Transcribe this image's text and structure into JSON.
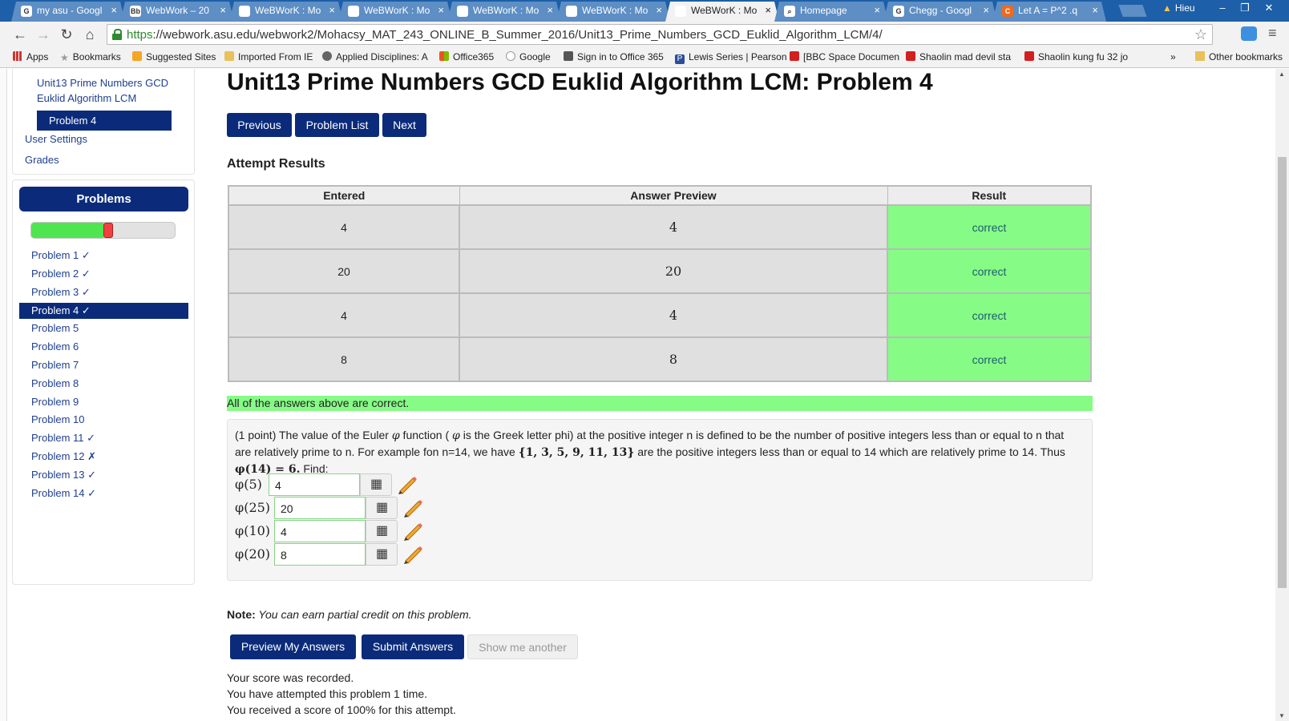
{
  "browser": {
    "tabs": [
      {
        "title": "my asu - Googl",
        "icon": "G"
      },
      {
        "title": "WebWork – 20",
        "icon": "Bb"
      },
      {
        "title": "WeBWorK : Mo",
        "icon": "doc"
      },
      {
        "title": "WeBWorK : Mo",
        "icon": "doc"
      },
      {
        "title": "WeBWorK : Mo",
        "icon": "doc"
      },
      {
        "title": "WeBWorK : Mo",
        "icon": "doc"
      },
      {
        "title": "WeBWorK : Mo",
        "icon": "doc"
      },
      {
        "title": "Homepage",
        "icon": "search"
      },
      {
        "title": "Chegg - Googl",
        "icon": "G"
      },
      {
        "title": "Let A = P^2 .q",
        "icon": "C"
      }
    ],
    "active_tab_index": 6,
    "user": "Hieu",
    "url_https": "https",
    "url_rest": "://webwork.asu.edu/webwork2/Mohacsy_MAT_243_ONLINE_B_Summer_2016/Unit13_Prime_Numbers_GCD_Euklid_Algorithm_LCM/4/",
    "bookmarks": [
      "Apps",
      "Bookmarks",
      "Suggested Sites",
      "Imported From IE",
      "Applied Disciplines: A",
      "Office365",
      "Google",
      "Sign in to Office 365",
      "Lewis Series | Pearson",
      "[BBC Space Documen",
      "Shaolin mad devil sta",
      "Shaolin kung fu 32 jo"
    ],
    "bookmark_overflow": "»",
    "other_bookmarks": "Other bookmarks"
  },
  "sidebar": {
    "set_link_line1": "Unit13 Prime Numbers GCD",
    "set_link_line2": "Euklid Algorithm LCM",
    "active_problem": "Problem 4",
    "user_settings": "User Settings",
    "grades": "Grades",
    "problems_header": "Problems",
    "progress_correct_fraction": 0.5,
    "progress_incorrect_fraction": 0.071,
    "problems": [
      {
        "label": "Problem 1 ✓",
        "current": false
      },
      {
        "label": "Problem 2 ✓",
        "current": false
      },
      {
        "label": "Problem 3 ✓",
        "current": false
      },
      {
        "label": "Problem 4 ✓",
        "current": true
      },
      {
        "label": "Problem 5",
        "current": false
      },
      {
        "label": "Problem 6",
        "current": false
      },
      {
        "label": "Problem 7",
        "current": false
      },
      {
        "label": "Problem 8",
        "current": false
      },
      {
        "label": "Problem 9",
        "current": false
      },
      {
        "label": "Problem 10",
        "current": false
      },
      {
        "label": "Problem 11 ✓",
        "current": false
      },
      {
        "label": "Problem 12 ✗",
        "current": false
      },
      {
        "label": "Problem 13 ✓",
        "current": false
      },
      {
        "label": "Problem 14 ✓",
        "current": false
      }
    ]
  },
  "main": {
    "title": "Unit13 Prime Numbers GCD Euklid Algorithm LCM: Problem 4",
    "nav": {
      "previous": "Previous",
      "problem_list": "Problem List",
      "next": "Next"
    },
    "attempt_title": "Attempt Results",
    "table_headers": [
      "Entered",
      "Answer Preview",
      "Result"
    ],
    "table_rows": [
      {
        "entered": "4",
        "preview": "4",
        "result": "correct"
      },
      {
        "entered": "20",
        "preview": "20",
        "result": "correct"
      },
      {
        "entered": "4",
        "preview": "4",
        "result": "correct"
      },
      {
        "entered": "8",
        "preview": "8",
        "result": "correct"
      }
    ],
    "all_correct": "All of the answers above are correct.",
    "problem": {
      "p1": "(1 point) The value of the Euler ",
      "phi": "φ",
      "p2": " function ( ",
      "p3": " is the Greek letter phi) at the positive integer n is defined to be the number of positive integers less than or equal to n that are relatively prime to n. For example fon n=14, we have ",
      "set": "{1, 3, 5, 9, 11, 13}",
      "p4": " are the positive integers less than or equal to 14 which are relatively prime to 14. Thus ",
      "thus_expr": "φ(14) = 6.",
      "p5": " Find:",
      "answers": [
        {
          "label": "φ(5)",
          "value": "4"
        },
        {
          "label": "φ(25)",
          "value": "20"
        },
        {
          "label": "φ(10)",
          "value": "4"
        },
        {
          "label": "φ(20)",
          "value": "8"
        }
      ]
    },
    "note_label": "Note:",
    "note_text": " You can earn partial credit on this problem.",
    "buttons": {
      "preview": "Preview My Answers",
      "submit": "Submit Answers",
      "another": "Show me another"
    },
    "status": [
      "Your score was recorded.",
      "You have attempted this problem 1 time.",
      "You received a score of 100% for this attempt."
    ]
  }
}
